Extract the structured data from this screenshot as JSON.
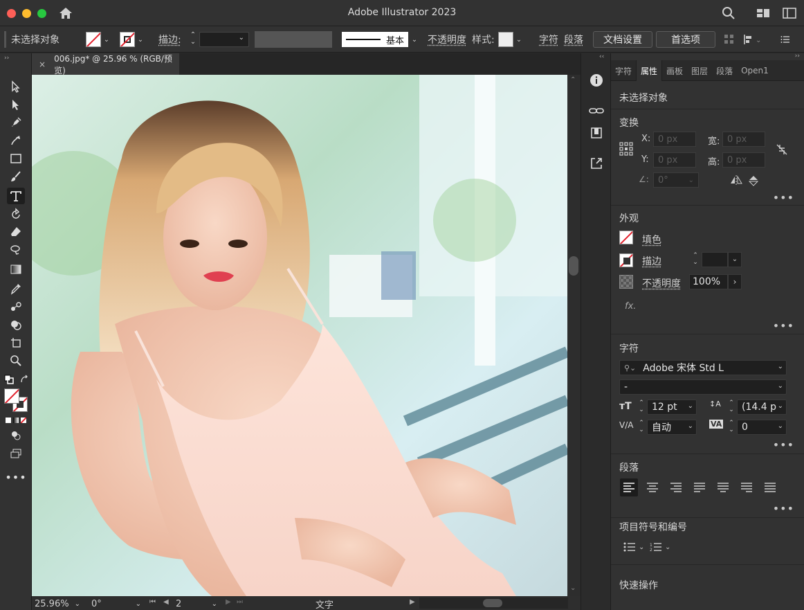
{
  "window": {
    "title": "Adobe Illustrator 2023"
  },
  "controlbar": {
    "selection_label": "未选择对象",
    "stroke_label": "描边:",
    "stroke_style": "基本",
    "opacity_label": "不透明度",
    "style_label": "样式:",
    "char_link": "字符",
    "para_link": "段落",
    "doc_setup_button": "文档设置",
    "prefs_button": "首选项"
  },
  "document_tab": {
    "title": "006.jpg* @ 25.96 % (RGB/预览)",
    "close": "×"
  },
  "statusbar": {
    "zoom": "25.96%",
    "rotation": "0°",
    "artboard": "2",
    "mode": "文字"
  },
  "panel": {
    "tabs": [
      "字符",
      "属性",
      "画板",
      "图层",
      "段落",
      "Open1"
    ],
    "active_tab": "属性",
    "no_selection": "未选择对象",
    "transform": {
      "title": "变换",
      "x_label": "X:",
      "x_value": "0 px",
      "y_label": "Y:",
      "y_value": "0 px",
      "w_label": "宽:",
      "w_value": "0 px",
      "h_label": "高:",
      "h_value": "0 px",
      "angle_value": "0°"
    },
    "appearance": {
      "title": "外观",
      "fill_label": "填色",
      "stroke_label": "描边",
      "opacity_label": "不透明度",
      "opacity_value": "100%",
      "fx_label": "fx."
    },
    "character": {
      "title": "字符",
      "font_family": "Adobe 宋体 Std L",
      "font_style": "-",
      "font_size": "12 pt",
      "leading": "(14.4 p",
      "kerning": "自动",
      "tracking": "0"
    },
    "paragraph": {
      "title": "段落"
    },
    "bullets": {
      "title": "项目符号和编号"
    },
    "quick_actions": {
      "title": "快速操作"
    }
  },
  "colors": {
    "chrome": "#323232",
    "panel_dark": "#262626",
    "accent_red": "#e2202c"
  }
}
